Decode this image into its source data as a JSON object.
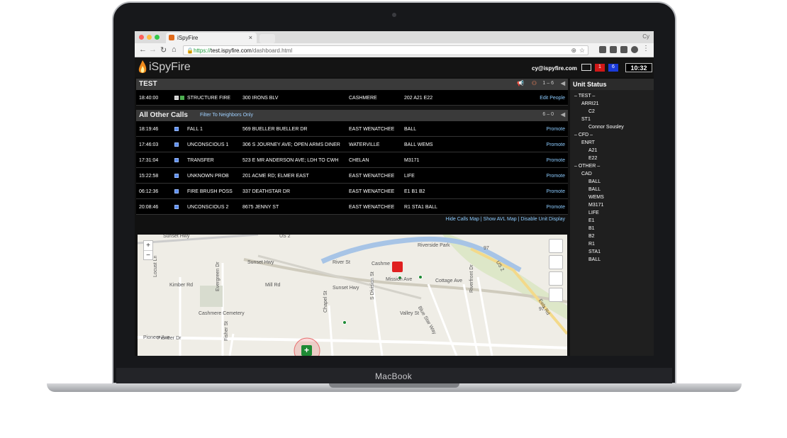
{
  "browser": {
    "tab_title": "iSpyFire",
    "tab_close": "×",
    "profile": "Cy",
    "url_scheme": "https://",
    "url_host": "test.ispyfire.com",
    "url_path": "/dashboard.html"
  },
  "app": {
    "logo_text": "iSpyFire",
    "user": "cy@ispyfire.com",
    "badge_red": "1",
    "badge_blue": "6",
    "clock": "10:32"
  },
  "test_section": {
    "title": "TEST",
    "count": "1 – 6",
    "row": {
      "time": "18:40:00",
      "type": "STRUCTURE FIRE",
      "address": "300 IRONS BLV",
      "city": "CASHMERE",
      "units": "202 A21 E22",
      "action": "Edit People"
    }
  },
  "other_section": {
    "title": "All Other Calls",
    "filter": "Filter To Neighbors Only",
    "count": "6 – 0",
    "rows": [
      {
        "time": "18:19:46",
        "type": "FALL 1",
        "address": "569 BUELLER BUELLER DR",
        "city": "EAST WENATCHEE",
        "units": "BALL",
        "action": "Promote"
      },
      {
        "time": "17:46:03",
        "type": "UNCONSCIOUS 1",
        "address": "306 S JOURNEY AVE; OPEN ARMS DINER",
        "city": "WATERVILLE",
        "units": "BALL WEMS",
        "action": "Promote"
      },
      {
        "time": "17:31:04",
        "type": "TRANSFER",
        "address": "523 E MR ANDERSON AVE; LDH TO CWH",
        "city": "CHELAN",
        "units": "M3171",
        "action": "Promote"
      },
      {
        "time": "15:22:58",
        "type": "UNKNOWN PROB",
        "address": "201 ACME RD; ELMER EAST",
        "city": "EAST WENATCHEE",
        "units": "LIFE",
        "action": "Promote"
      },
      {
        "time": "06:12:36",
        "type": "FIRE BRUSH POSS",
        "address": "337 DEATHSTAR DR",
        "city": "EAST WENATCHEE",
        "units": "E1 B1 B2",
        "action": "Promote"
      },
      {
        "time": "20:08:46",
        "type": "UNCONSCIOUS 2",
        "address": "8675 JENNY ST",
        "city": "EAST WENATCHEE",
        "units": "R1 STA1 BALL",
        "action": "Promote"
      }
    ]
  },
  "map_links": "Hide Calls Map | Show AVL Map | Disable Unit Display",
  "map": {
    "zoom_in": "+",
    "zoom_out": "−",
    "labels": [
      "Sunset Hwy",
      "US 2",
      "Riverside Park",
      "River St",
      "Cashme",
      "Sunset Hwy",
      "Mission Ave",
      "Cottage Ave",
      "Kimber Rd",
      "Mill Rd",
      "Sunset Hwy",
      "Locust Ln",
      "Evergreen Dr",
      "Cashmere Cemetery",
      "S Division St",
      "Valley St",
      "Chapel St",
      "Blue Star Way",
      "Pioneer Ave",
      "Pioneer Dr",
      "Fisher St",
      "Riverfront Dr",
      "US 2",
      "Eels Rd",
      "97",
      "97"
    ]
  },
  "unit_status": {
    "title": "Unit Status",
    "items": [
      {
        "text": "– TEST –",
        "indent": 0
      },
      {
        "text": "ARRI21",
        "indent": 1
      },
      {
        "text": "C2",
        "indent": 2
      },
      {
        "text": "ST1",
        "indent": 1
      },
      {
        "text": "Connor Sousley",
        "indent": 2
      },
      {
        "text": "– CFD –",
        "indent": 0
      },
      {
        "text": "ENRT",
        "indent": 1
      },
      {
        "text": "A21",
        "indent": 2
      },
      {
        "text": "E22",
        "indent": 2
      },
      {
        "text": "– OTHER –",
        "indent": 0
      },
      {
        "text": "CAD",
        "indent": 1
      },
      {
        "text": "BALL",
        "indent": 2
      },
      {
        "text": "BALL",
        "indent": 2
      },
      {
        "text": "WEMS",
        "indent": 2
      },
      {
        "text": "M3171",
        "indent": 2
      },
      {
        "text": "LIFE",
        "indent": 2
      },
      {
        "text": "E1",
        "indent": 2
      },
      {
        "text": "B1",
        "indent": 2
      },
      {
        "text": "B2",
        "indent": 2
      },
      {
        "text": "R1",
        "indent": 2
      },
      {
        "text": "STA1",
        "indent": 2
      },
      {
        "text": "BALL",
        "indent": 2
      }
    ]
  },
  "device_label": "MacBook",
  "colors": {
    "accent_link": "#8ccbff",
    "badge_red": "#d01818",
    "badge_blue": "#1a3ad8",
    "marker_red": "#e02020",
    "marker_green": "#1e8a34"
  }
}
